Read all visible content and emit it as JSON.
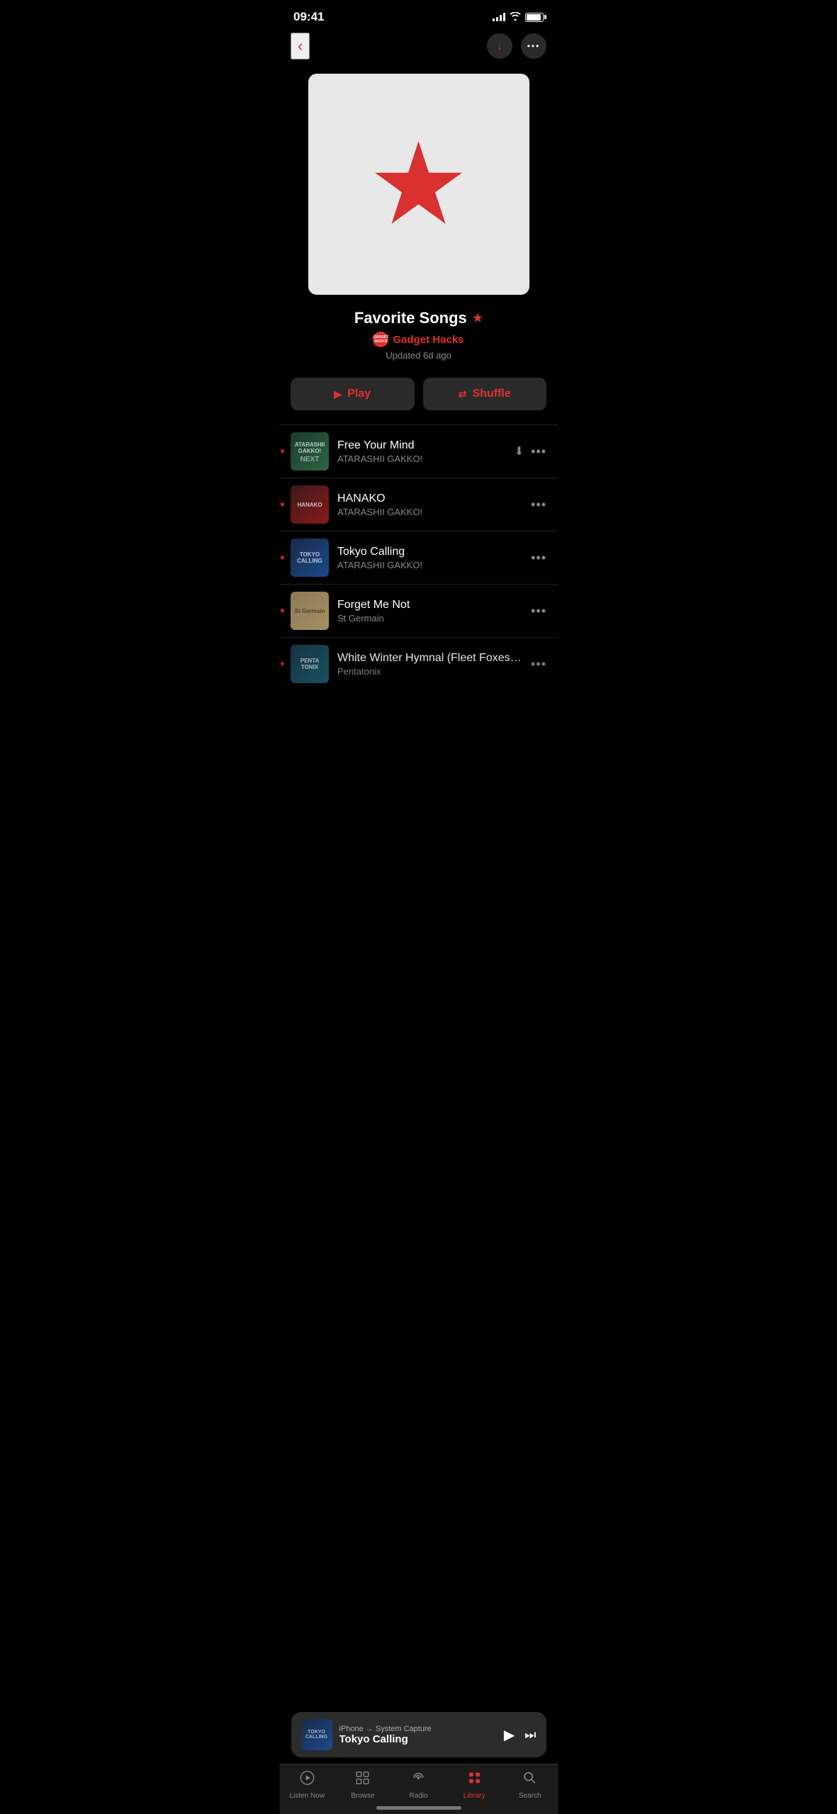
{
  "statusBar": {
    "time": "09:41",
    "signalBars": [
      4,
      6,
      8,
      10,
      12
    ],
    "battery": 90
  },
  "navigation": {
    "backLabel": "‹",
    "downloadLabel": "↓",
    "moreLabel": "•••"
  },
  "playlist": {
    "title": "Favorite Songs",
    "titleStar": "★",
    "authorAvatar": "GADGET\nHACKS",
    "authorName": "Gadget Hacks",
    "updatedText": "Updated 6d ago"
  },
  "actions": {
    "playLabel": "Play",
    "shuffleLabel": "Shuffle"
  },
  "tracks": [
    {
      "id": 1,
      "title": "Free Your Mind",
      "artist": "ATARASHII GAKKO!",
      "hasStar": true,
      "hasDownload": true,
      "thumbClass": "thumb-green",
      "thumbLabel": "ATARASHII GAKKO!\nNEXT"
    },
    {
      "id": 2,
      "title": "HANAKO",
      "artist": "ATARASHII GAKKO!",
      "hasStar": true,
      "hasDownload": false,
      "thumbClass": "thumb-red-dark",
      "thumbLabel": "HANAKO"
    },
    {
      "id": 3,
      "title": "Tokyo Calling",
      "artist": "ATARASHII GAKKO!",
      "hasStar": true,
      "hasDownload": false,
      "thumbClass": "thumb-blue",
      "thumbLabel": "TOKYO\nCALLING"
    },
    {
      "id": 4,
      "title": "Forget Me Not",
      "artist": "St Germain",
      "hasStar": true,
      "hasDownload": false,
      "thumbClass": "thumb-beige",
      "thumbLabel": "St Germain"
    },
    {
      "id": 5,
      "title": "White Winter Hymnal (Fleet Foxes Cover)",
      "artist": "Pentatonix",
      "hasStar": true,
      "hasDownload": false,
      "thumbClass": "thumb-teal",
      "thumbLabel": "PENTA\nTONIX"
    }
  ],
  "miniPlayer": {
    "subtitle": "iPhone → System Capture",
    "title": "Tokyo Calling",
    "thumbClass": "thumb-blue"
  },
  "tabBar": {
    "tabs": [
      {
        "id": "listen-now",
        "icon": "▶",
        "label": "Listen Now",
        "active": false
      },
      {
        "id": "browse",
        "icon": "⊞",
        "label": "Browse",
        "active": false
      },
      {
        "id": "radio",
        "icon": "((·))",
        "label": "Radio",
        "active": false
      },
      {
        "id": "library",
        "icon": "🎵",
        "label": "Library",
        "active": true
      },
      {
        "id": "search",
        "icon": "🔍",
        "label": "Search",
        "active": false
      }
    ]
  }
}
